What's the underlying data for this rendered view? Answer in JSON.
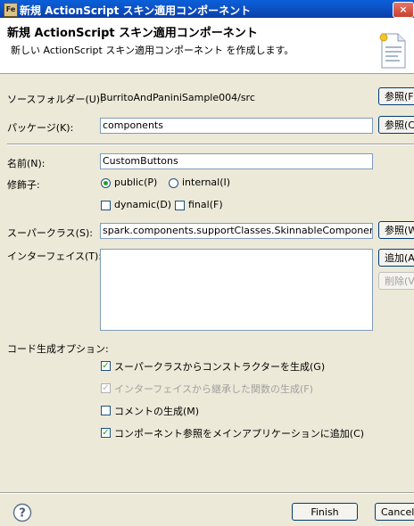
{
  "window": {
    "icon": "Fe",
    "title": "新規 ActionScript スキン適用コンポーネント",
    "close_glyph": "×"
  },
  "header": {
    "title": "新規 ActionScript スキン適用コンポーネント",
    "description": "新しい ActionScript スキン適用コンポーネント を作成します。",
    "icon": "new-file-wizard-icon"
  },
  "form": {
    "source_folder": {
      "label": "ソースフォルダー(U):",
      "value": "BurritoAndPaniniSample004/src",
      "browse": "参照(F"
    },
    "package": {
      "label": "パッケージ(K):",
      "value": "components",
      "browse": "参照(C"
    },
    "name": {
      "label": "名前(N):",
      "value": "CustomButtons"
    },
    "modifiers": {
      "label": "修飾子:",
      "public": "public(P)",
      "internal": "internal(I)",
      "dynamic": "dynamic(D)",
      "final": "final(F)"
    },
    "superclass": {
      "label": "スーパークラス(S):",
      "value": "spark.components.supportClasses.SkinnableComponent",
      "browse": "参照(W"
    },
    "interfaces": {
      "label": "インターフェイス(T):",
      "add": "追加(A",
      "remove": "削除(V"
    },
    "codegen": {
      "label": "コード生成オプション:",
      "options": [
        {
          "label": "スーパークラスからコンストラクターを生成(G)",
          "checked": true,
          "enabled": true
        },
        {
          "label": "インターフェイスから継承した関数の生成(F)",
          "checked": true,
          "enabled": false
        },
        {
          "label": "コメントの生成(M)",
          "checked": false,
          "enabled": true
        },
        {
          "label": "コンポーネント参照をメインアプリケーションに追加(C)",
          "checked": true,
          "enabled": true
        }
      ]
    }
  },
  "footer": {
    "help_icon": "help-icon",
    "finish": "Finish",
    "cancel": "Cancel"
  }
}
